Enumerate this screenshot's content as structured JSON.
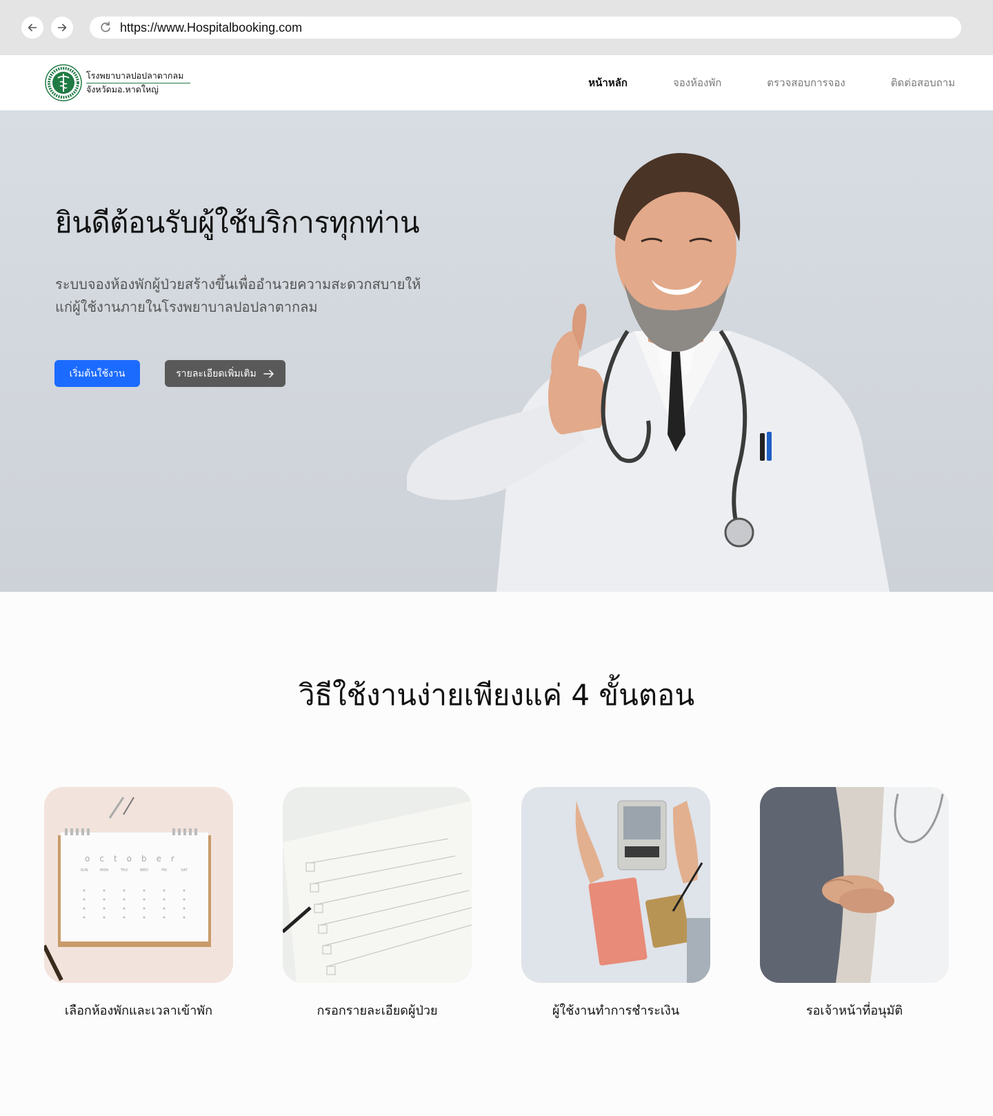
{
  "browser": {
    "url": "https://www.Hospitalbooking.com",
    "back_icon": "arrow-left-icon",
    "forward_icon": "arrow-right-icon",
    "reload_icon": "reload-icon"
  },
  "header": {
    "logo_line1": "โรงพยาบาลปอปลาตากลม",
    "logo_line2": "จังหวัดมอ.หาดใหญ่",
    "nav": [
      {
        "label": "หน้าหลัก",
        "active": true
      },
      {
        "label": "จองห้องพัก",
        "active": false
      },
      {
        "label": "ตรวจสอบการจอง",
        "active": false
      },
      {
        "label": "ติดต่อสอบถาม",
        "active": false
      }
    ]
  },
  "hero": {
    "title": "ยินดีต้อนรับผู้ใช้บริการทุกท่าน",
    "desc_line1": "ระบบจองห้องพักผู้ป่วยสร้างขึ้นเพื่ออำนวยความสะดวกสบายให้",
    "desc_line2": "แก่ผู้ใช้งานภายในโรงพยาบาลปอปลาตากลม",
    "primary_button": "เริ่มต้นใช้งาน",
    "secondary_button": "รายละเอียดเพิ่มเติม",
    "colors": {
      "primary": "#1c6bff",
      "secondary": "#595959"
    }
  },
  "steps": {
    "title": "วิธีใช้งานง่ายเพียงแค่ 4 ขั้นตอน",
    "items": [
      {
        "label": "เลือกห้องพักและเวลาเข้าพัก",
        "image": "calendar-image"
      },
      {
        "label": "กรอกรายละเอียดผู้ป่วย",
        "image": "checklist-image"
      },
      {
        "label": "ผู้ใช้งานทำการชำระเงิน",
        "image": "payment-image"
      },
      {
        "label": "รอเจ้าหน้าที่อนุมัติ",
        "image": "holding-hands-image"
      }
    ],
    "calendar_month": "october",
    "calendar_days": [
      "SUN",
      "MON",
      "THU",
      "WED",
      "FRI",
      "SAT"
    ]
  }
}
